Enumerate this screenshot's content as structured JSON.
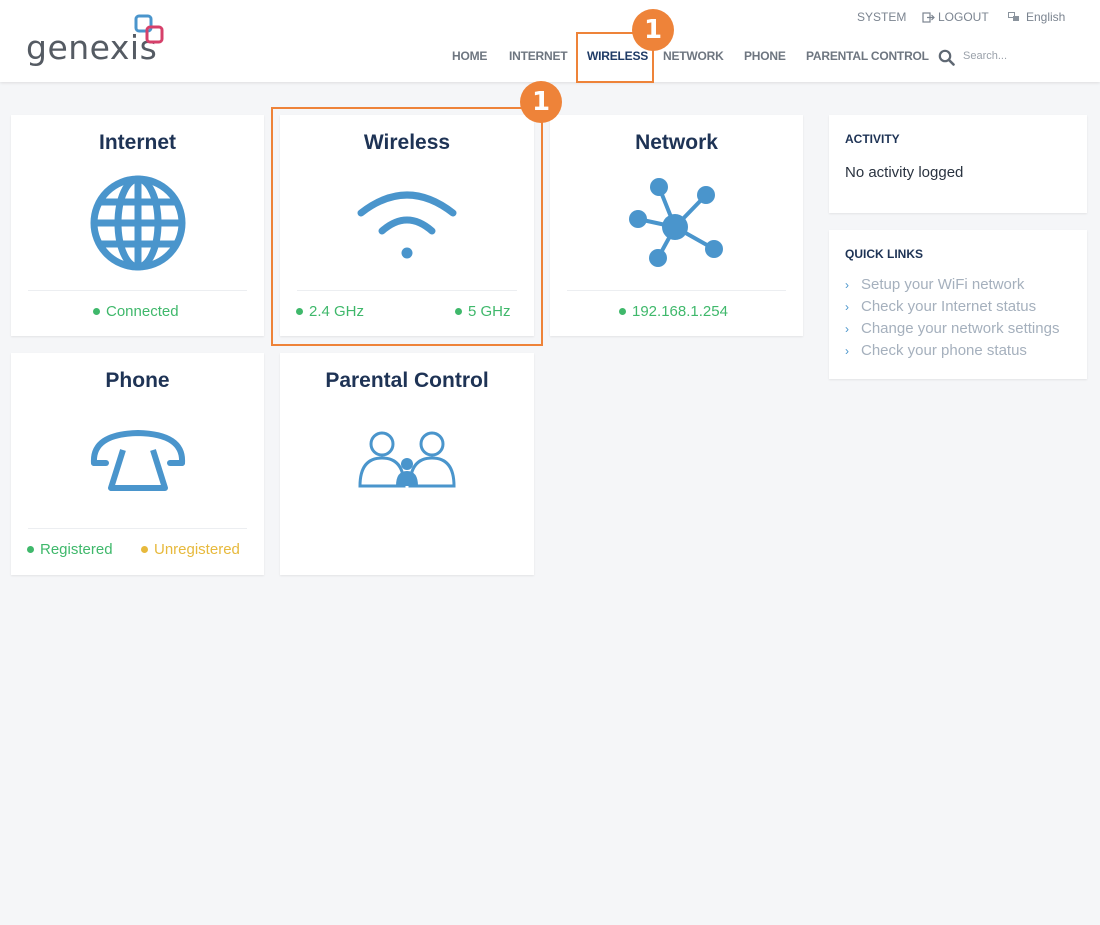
{
  "brand": {
    "logo_text": "genexis",
    "accent": "#4a95cc",
    "annotation_color": "#ee8339"
  },
  "header": {
    "system_label": "SYSTEM",
    "logout_label": "LOGOUT",
    "language_label": "English",
    "nav": {
      "home": "HOME",
      "internet": "INTERNET",
      "wireless": "WIRELESS",
      "network": "NETWORK",
      "phone": "PHONE",
      "parental_control": "PARENTAL CONTROL"
    },
    "active_nav": "WIRELESS",
    "search_placeholder": "Search..."
  },
  "cards": {
    "internet": {
      "title": "Internet",
      "icon": "globe-icon",
      "status": "Connected"
    },
    "wireless": {
      "title": "Wireless",
      "icon": "wifi-icon",
      "status_left": "2.4 GHz",
      "status_right": "5 GHz"
    },
    "network": {
      "title": "Network",
      "icon": "network-icon",
      "status": "192.168.1.254"
    },
    "phone": {
      "title": "Phone",
      "icon": "phone-icon",
      "status_left": "Registered",
      "status_right": "Unregistered"
    },
    "parental_control": {
      "title": "Parental Control",
      "icon": "parental-control-icon"
    }
  },
  "activity": {
    "title": "ACTIVITY",
    "text": "No activity logged"
  },
  "quick_links": {
    "title": "QUICK LINKS",
    "items": [
      "Setup your WiFi network",
      "Check your Internet status",
      "Change your network settings",
      "Check your phone status"
    ]
  },
  "annotations": {
    "nav_badge": "1",
    "card_badge": "1"
  },
  "status_colors": {
    "ok": "#3fb86b",
    "warning": "#e7b93c"
  }
}
